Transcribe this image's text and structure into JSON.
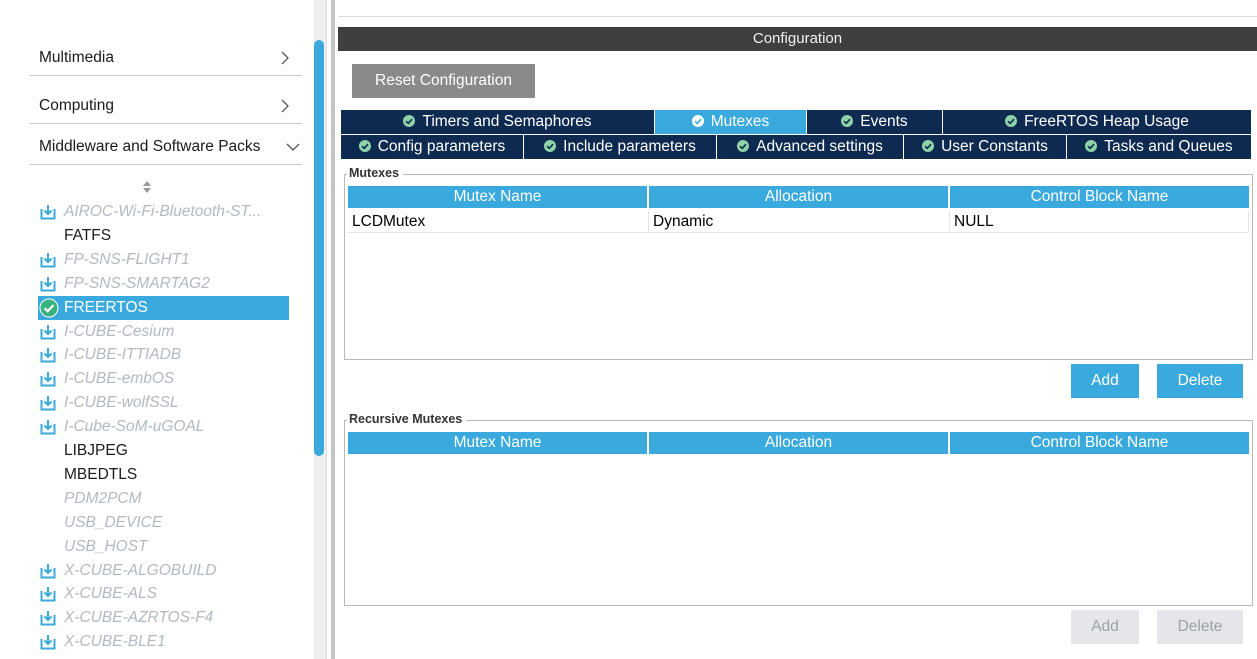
{
  "sidebar": {
    "categories": [
      {
        "label": "Multimedia",
        "chevron": "chevron-right"
      },
      {
        "label": "Computing",
        "chevron": "chevron-right"
      },
      {
        "label": "Middleware and Software Packs",
        "chevron": "chevron-down"
      }
    ],
    "items": [
      {
        "label": "AIROC-Wi-Fi-Bluetooth-ST...",
        "icon": "download-icon",
        "state": "dim"
      },
      {
        "label": "FATFS",
        "icon": "",
        "state": "dark"
      },
      {
        "label": "FP-SNS-FLIGHT1",
        "icon": "download-icon",
        "state": "dim"
      },
      {
        "label": "FP-SNS-SMARTAG2",
        "icon": "download-icon",
        "state": "dim"
      },
      {
        "label": "FREERTOS",
        "icon": "check-circle-icon",
        "state": "selected"
      },
      {
        "label": "I-CUBE-Cesium",
        "icon": "download-icon",
        "state": "dim"
      },
      {
        "label": "I-CUBE-ITTIADB",
        "icon": "download-icon",
        "state": "dim"
      },
      {
        "label": "I-CUBE-embOS",
        "icon": "download-icon",
        "state": "dim"
      },
      {
        "label": "I-CUBE-wolfSSL",
        "icon": "download-icon",
        "state": "dim"
      },
      {
        "label": "I-Cube-SoM-uGOAL",
        "icon": "download-icon",
        "state": "dim"
      },
      {
        "label": "LIBJPEG",
        "icon": "",
        "state": "dark"
      },
      {
        "label": "MBEDTLS",
        "icon": "",
        "state": "dark"
      },
      {
        "label": "PDM2PCM",
        "icon": "",
        "state": "dim"
      },
      {
        "label": "USB_DEVICE",
        "icon": "",
        "state": "dim"
      },
      {
        "label": "USB_HOST",
        "icon": "",
        "state": "dim"
      },
      {
        "label": "X-CUBE-ALGOBUILD",
        "icon": "download-icon",
        "state": "dim"
      },
      {
        "label": "X-CUBE-ALS",
        "icon": "download-icon",
        "state": "dim"
      },
      {
        "label": "X-CUBE-AZRTOS-F4",
        "icon": "download-icon",
        "state": "dim"
      },
      {
        "label": "X-CUBE-BLE1",
        "icon": "download-icon",
        "state": "dim"
      }
    ]
  },
  "config": {
    "header": "Configuration",
    "reset_label": "Reset Configuration",
    "tabs_row1": [
      {
        "label": "Timers and Semaphores",
        "active": false
      },
      {
        "label": "Mutexes",
        "active": true
      },
      {
        "label": "Events",
        "active": false
      },
      {
        "label": "FreeRTOS Heap Usage",
        "active": false
      }
    ],
    "tabs_row2": [
      {
        "label": "Config parameters",
        "active": false
      },
      {
        "label": "Include parameters",
        "active": false
      },
      {
        "label": "Advanced settings",
        "active": false
      },
      {
        "label": "User Constants",
        "active": false
      },
      {
        "label": "Tasks and Queues",
        "active": false
      }
    ]
  },
  "mutexes": {
    "legend": "Mutexes",
    "columns": [
      "Mutex Name",
      "Allocation",
      "Control Block Name"
    ],
    "rows": [
      [
        "LCDMutex",
        "Dynamic",
        "NULL"
      ]
    ],
    "add_label": "Add",
    "delete_label": "Delete"
  },
  "recursive_mutexes": {
    "legend": "Recursive Mutexes",
    "columns": [
      "Mutex Name",
      "Allocation",
      "Control Block Name"
    ],
    "rows": [],
    "add_label": "Add",
    "delete_label": "Delete"
  },
  "colors": {
    "accent": "#3aa9dd",
    "tab_dark": "#0e2a50",
    "header_dark": "#3f3f3f",
    "check_green": "#36b37e"
  }
}
